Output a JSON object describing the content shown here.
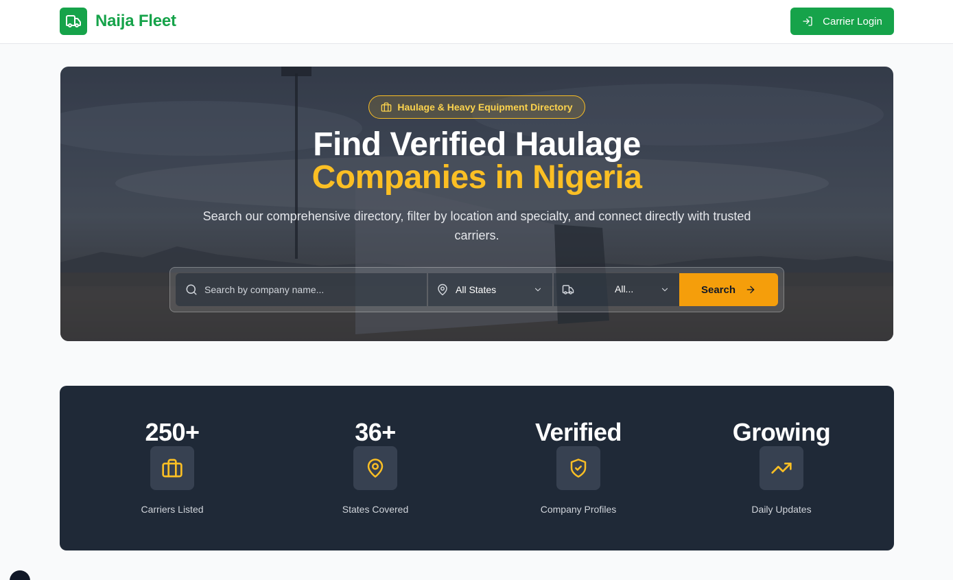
{
  "header": {
    "brand_name": "Naija Fleet",
    "login_label": "Carrier Login"
  },
  "hero": {
    "badge": "Haulage & Heavy Equipment Directory",
    "title_line1": "Find Verified Haulage",
    "title_line2": "Companies in Nigeria",
    "subtitle": "Search our comprehensive directory, filter by location and specialty, and connect directly with trusted carriers.",
    "search_placeholder": "Search by company name...",
    "state_value": "All States",
    "type_value": "All...",
    "search_button": "Search"
  },
  "stats": [
    {
      "value": "250+",
      "label": "Carriers Listed",
      "icon": "briefcase-icon"
    },
    {
      "value": "36+",
      "label": "States Covered",
      "icon": "map-pin-icon"
    },
    {
      "value": "Verified",
      "label": "Company Profiles",
      "icon": "shield-check-icon"
    },
    {
      "value": "Growing",
      "label": "Daily Updates",
      "icon": "trending-up-icon"
    }
  ],
  "colors": {
    "brand_green": "#16a34a",
    "accent_amber": "#f59e0b",
    "highlight_yellow": "#fbbf24",
    "stats_bg": "#1f2937"
  }
}
